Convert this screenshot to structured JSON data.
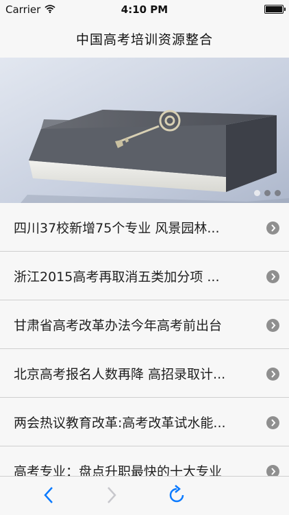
{
  "status_bar": {
    "carrier": "Carrier",
    "time": "4:10 PM"
  },
  "nav": {
    "title": "中国高考培训资源整合"
  },
  "banner": {
    "image": "book-with-key",
    "pages": 3,
    "active_page": 0
  },
  "news": [
    {
      "title": "四川37校新增75个专业 风景园林..."
    },
    {
      "title": "浙江2015高考再取消五类加分项 ..."
    },
    {
      "title": "甘肃省高考改革办法今年高考前出台"
    },
    {
      "title": "北京高考报名人数再降 高招录取计..."
    },
    {
      "title": "两会热议教育改革:高考改革试水能..."
    },
    {
      "title": "高考专业：盘点升职最快的十大专业"
    }
  ],
  "toolbar": {
    "back_icon": "chevron-left-icon",
    "forward_icon": "chevron-right-icon",
    "refresh_icon": "refresh-icon"
  },
  "colors": {
    "accent": "#0a7aff",
    "disabled": "#c7c7cc"
  }
}
